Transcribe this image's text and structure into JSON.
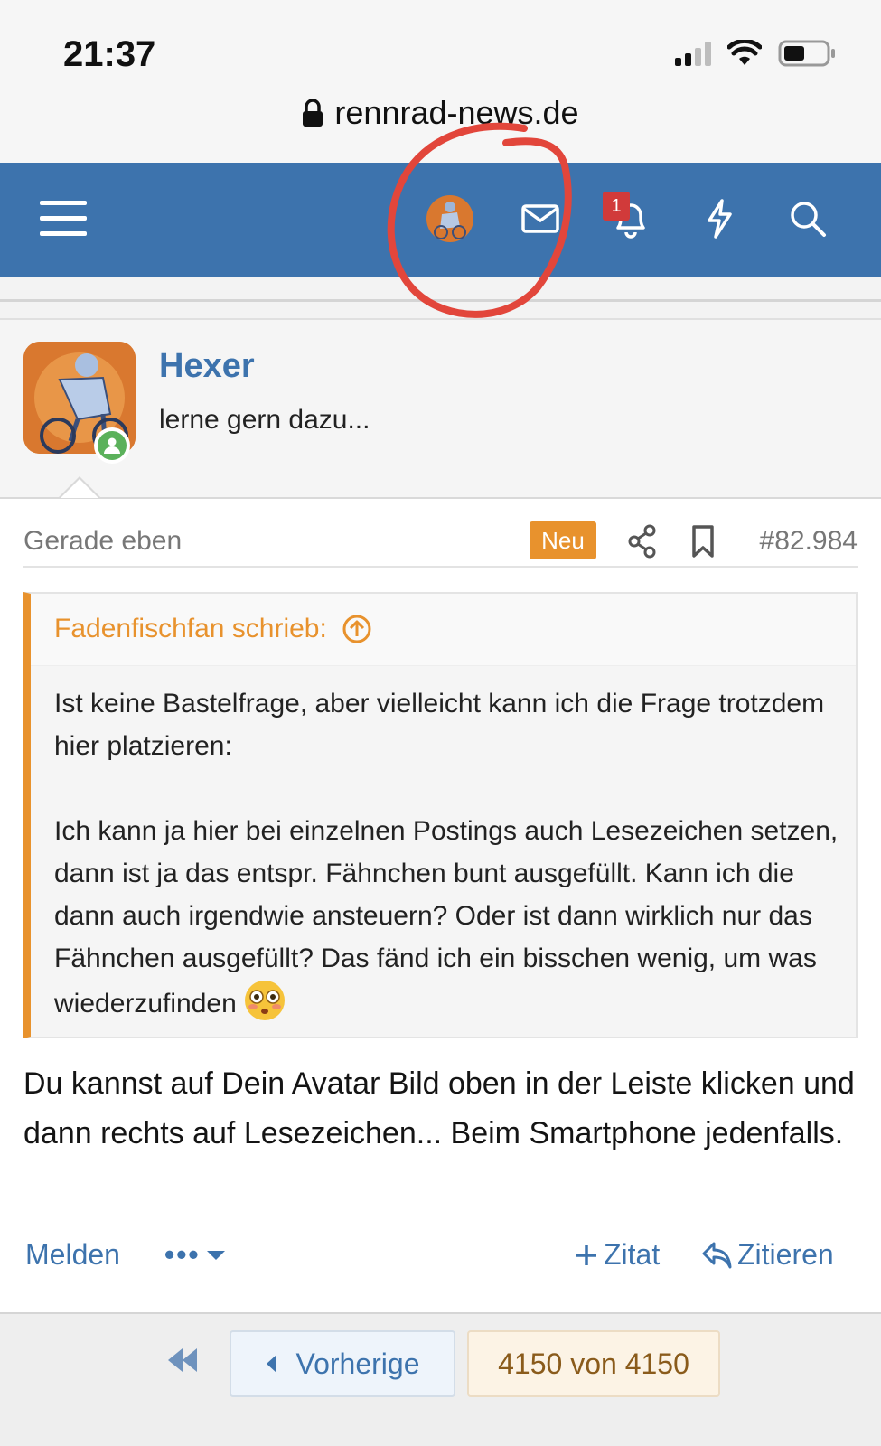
{
  "status_bar": {
    "time": "21:37"
  },
  "browser": {
    "url": "rennrad-news.de"
  },
  "nav": {
    "notification_count": "1",
    "icons": [
      "menu-icon",
      "user-avatar",
      "mail-icon",
      "bell-icon",
      "lightning-icon",
      "search-icon"
    ]
  },
  "post": {
    "username": "Hexer",
    "user_title": "lerne gern dazu...",
    "date": "Gerade eben",
    "new_badge": "Neu",
    "post_number": "#82.984",
    "quote": {
      "author": "Fadenfischfan schrieb:",
      "paragraph1": "Ist keine Bastelfrage, aber vielleicht kann ich die Frage trotzdem hier platzieren:",
      "paragraph2": "Ich kann ja hier bei einzelnen Postings auch Lesezeichen setzen, dann ist ja das entspr. Fähnchen bunt ausgefüllt. Kann ich die dann auch irgendwie ansteuern? Oder ist dann wirklich nur das Fähnchen ausgefüllt? Das fänd ich ein bisschen wenig, um was wiederzufinden"
    },
    "body": "Du kannst auf Dein Avatar Bild oben in der Leiste klicken und dann rechts auf Lesezeichen... Beim Smartphone jedenfalls.",
    "actions": {
      "report": "Melden",
      "more": "•••",
      "multiquote": "Zitat",
      "reply": "Zitieren"
    }
  },
  "pagination": {
    "previous": "Vorherige",
    "current": "4150 von 4150"
  },
  "colors": {
    "header_blue": "#3d73ad",
    "accent_orange": "#e8922d",
    "annotation_red": "#e2463b"
  }
}
